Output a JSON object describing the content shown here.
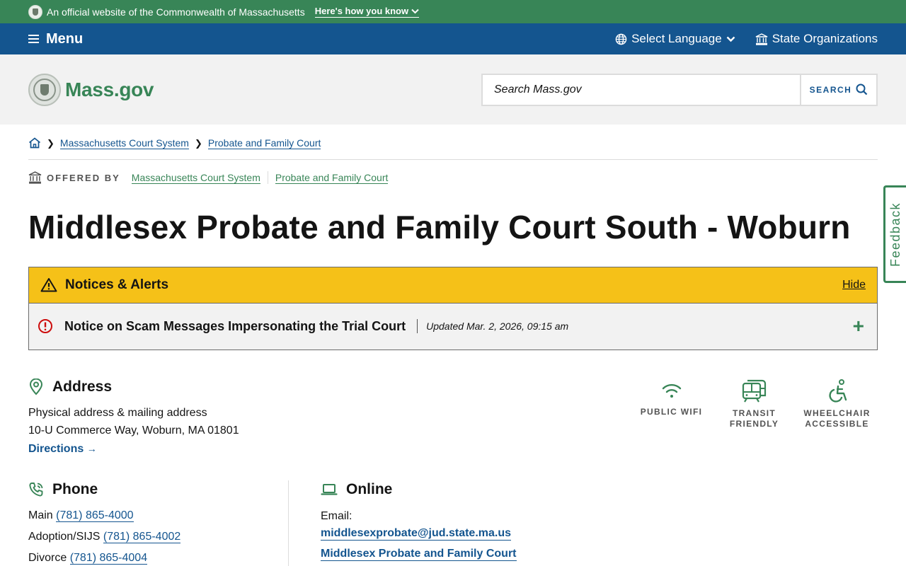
{
  "official": {
    "text": "An official website of the Commonwealth of Massachusetts",
    "howto": "Here's how you know"
  },
  "nav": {
    "menu": "Menu",
    "language": "Select Language",
    "orgs": "State Organizations"
  },
  "header": {
    "logo": "Mass.gov",
    "search_placeholder": "Search Mass.gov",
    "search_button": "SEARCH"
  },
  "breadcrumb": {
    "items": [
      "Massachusetts Court System",
      "Probate and Family Court"
    ]
  },
  "offered_by": {
    "label": "OFFERED BY",
    "orgs": [
      "Massachusetts Court System",
      "Probate and Family Court"
    ]
  },
  "page": {
    "title": "Middlesex Probate and Family Court South - Woburn"
  },
  "alerts": {
    "heading": "Notices & Alerts",
    "hide": "Hide",
    "items": [
      {
        "title": "Notice on Scam Messages Impersonating the Trial Court",
        "updated": "Updated Mar. 2, 2026, 09:15 am"
      }
    ]
  },
  "address": {
    "heading": "Address",
    "type": "Physical address & mailing address",
    "line": "10-U Commerce Way, Woburn, MA 01801",
    "directions": "Directions"
  },
  "amenities": [
    {
      "icon": "wifi-icon",
      "label": "PUBLIC WIFI"
    },
    {
      "icon": "bus-icon",
      "label": "TRANSIT FRIENDLY"
    },
    {
      "icon": "wheelchair-icon",
      "label": "WHEELCHAIR ACCESSIBLE"
    }
  ],
  "phone": {
    "heading": "Phone",
    "rows": [
      {
        "label": "Main",
        "number": "(781) 865-4000"
      },
      {
        "label": "Adoption/SIJS",
        "number": "(781) 865-4002"
      },
      {
        "label": "Divorce",
        "number": "(781) 865-4004"
      }
    ]
  },
  "online": {
    "heading": "Online",
    "email_label": "Email:",
    "email": "middlesexprobate@jud.state.ma.us",
    "link": "Middlesex Probate and Family Court"
  },
  "feedback": "Feedback",
  "colors": {
    "green": "#388557",
    "blue": "#14558f",
    "alert_yellow": "#f5c118",
    "alert_red": "#cd0d0d"
  }
}
